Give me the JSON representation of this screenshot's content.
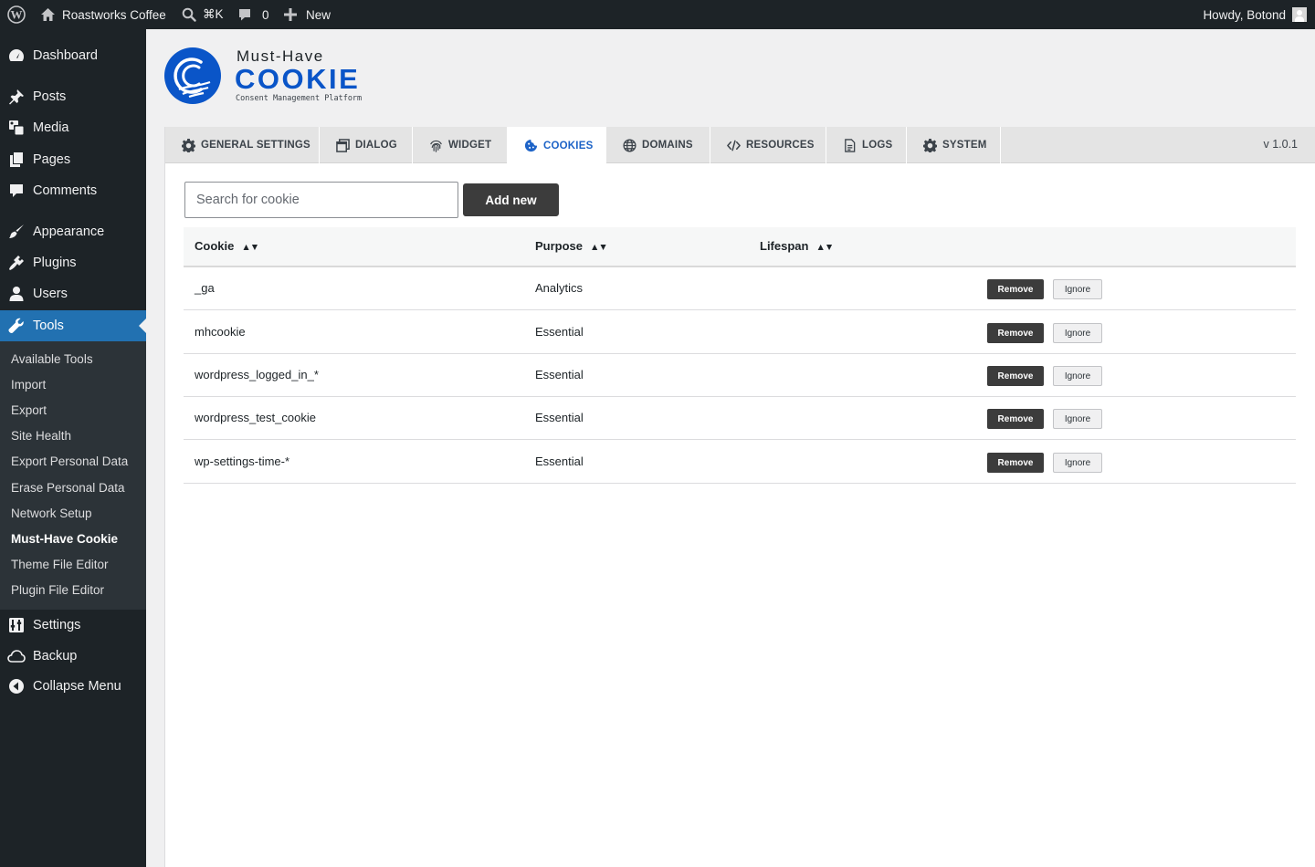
{
  "adminbar": {
    "site_name": "Roastworks Coffee",
    "search_shortcut": "⌘K",
    "comments_count": "0",
    "new_label": "New",
    "greeting": "Howdy, Botond"
  },
  "sidebar": {
    "items": [
      {
        "label": "Dashboard",
        "icon": "dashboard-icon"
      },
      {
        "label": "Posts",
        "icon": "pin-icon"
      },
      {
        "label": "Media",
        "icon": "media-icon"
      },
      {
        "label": "Pages",
        "icon": "pages-icon"
      },
      {
        "label": "Comments",
        "icon": "comment-icon"
      },
      {
        "label": "Appearance",
        "icon": "paintbrush-icon"
      },
      {
        "label": "Plugins",
        "icon": "plugin-icon"
      },
      {
        "label": "Users",
        "icon": "user-icon"
      },
      {
        "label": "Tools",
        "icon": "wrench-icon"
      },
      {
        "label": "Settings",
        "icon": "settings-icon"
      },
      {
        "label": "Backup",
        "icon": "cloud-icon"
      },
      {
        "label": "Collapse Menu",
        "icon": "collapse-icon"
      }
    ],
    "submenu": [
      "Available Tools",
      "Import",
      "Export",
      "Site Health",
      "Export Personal Data",
      "Erase Personal Data",
      "Network Setup",
      "Must-Have Cookie",
      "Theme File Editor",
      "Plugin File Editor"
    ]
  },
  "brand": {
    "line1": "Must-Have",
    "line2": "COOKIE",
    "line3": "Consent Management Platform"
  },
  "tabs": [
    {
      "label": "GENERAL SETTINGS",
      "icon": "gear-icon"
    },
    {
      "label": "DIALOG",
      "icon": "dialog-icon"
    },
    {
      "label": "WIDGET",
      "icon": "fingerprint-icon"
    },
    {
      "label": "COOKIES",
      "icon": "cookie-icon",
      "active": true
    },
    {
      "label": "DOMAINS",
      "icon": "globe-icon"
    },
    {
      "label": "RESOURCES",
      "icon": "code-icon"
    },
    {
      "label": "LOGS",
      "icon": "document-icon"
    },
    {
      "label": "SYSTEM",
      "icon": "gear-icon"
    }
  ],
  "version": "v 1.0.1",
  "search": {
    "placeholder": "Search for cookie",
    "value": ""
  },
  "add_new_label": "Add new",
  "table": {
    "columns": [
      "Cookie",
      "Purpose",
      "Lifespan"
    ],
    "sort_indicator": "▲▼",
    "rows": [
      {
        "cookie": "_ga",
        "purpose": "Analytics",
        "lifespan": ""
      },
      {
        "cookie": "mhcookie",
        "purpose": "Essential",
        "lifespan": ""
      },
      {
        "cookie": "wordpress_logged_in_*",
        "purpose": "Essential",
        "lifespan": ""
      },
      {
        "cookie": "wordpress_test_cookie",
        "purpose": "Essential",
        "lifespan": ""
      },
      {
        "cookie": "wp-settings-time-*",
        "purpose": "Essential",
        "lifespan": ""
      }
    ],
    "remove_label": "Remove",
    "ignore_label": "Ignore"
  },
  "colors": {
    "admin_dark": "#1d2327",
    "accent_blue": "#2271b1",
    "brand_blue": "#0a55c8",
    "active_tab": "#1d63c7"
  }
}
